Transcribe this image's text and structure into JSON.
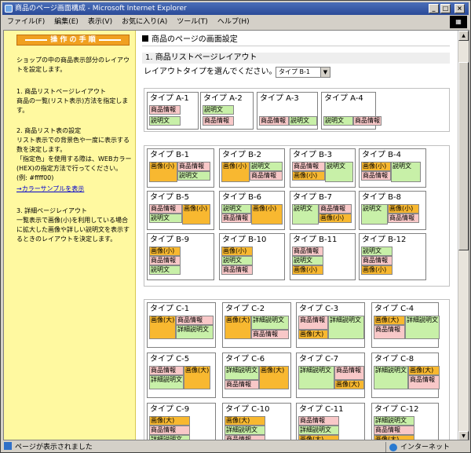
{
  "window": {
    "title": "商品のページ画面構成 - Microsoft Internet Explorer"
  },
  "menu": [
    "ファイル(F)",
    "編集(E)",
    "表示(V)",
    "お気に入り(A)",
    "ツール(T)",
    "ヘルプ(H)"
  ],
  "sidebar": {
    "heading": "操 作 の 手 順",
    "intro": "ショップの中の商品表示部分のレイアウトを設定します。",
    "step1_title": "1. 商品リストページレイアウト",
    "step1_body": "商品の一覧(リスト表示)方法を指定します。",
    "step2_title": "2. 商品リスト表の設定",
    "step2_body": "リスト表示での背景色や一度に表示する数を決定します。",
    "step2_note": "「指定色」を使用する際は、WEBカラー(HEX)の指定方法で行ってください。",
    "step2_example": "(例: #ffff00)",
    "color_link": "→カラーサンプルを表示",
    "step3_title": "3. 詳細ページレイアウト",
    "step3_body": "一覧表示で画像(小)を利用している場合に拡大した画像や詳しい説明文を表示するときのレイアウトを決定します。"
  },
  "main": {
    "title": "商品のページの画面設定",
    "section1": "1. 商品リストページレイアウト",
    "layout_prompt": "レイアウトタイプを選んでください。",
    "layout_selected": "タイプ B-1"
  },
  "groupA": [
    {
      "t": "タイプ A-1",
      "b": [
        "商品情報",
        "説明文"
      ]
    },
    {
      "t": "タイプ A-2",
      "b": [
        "説明文",
        "商品情報"
      ]
    },
    {
      "t": "タイプ A-3",
      "b": [
        "商品情報",
        "説明文"
      ]
    },
    {
      "t": "タイプ A-4",
      "b": [
        "説明文",
        "商品情報"
      ]
    }
  ],
  "groupB": [
    {
      "t": "タイプ B-1"
    },
    {
      "t": "タイプ B-2"
    },
    {
      "t": "タイプ B-3"
    },
    {
      "t": "タイプ B-4"
    },
    {
      "t": "タイプ B-5"
    },
    {
      "t": "タイプ B-6"
    },
    {
      "t": "タイプ B-7"
    },
    {
      "t": "タイプ B-8"
    },
    {
      "t": "タイプ B-9"
    },
    {
      "t": "タイプ B-10"
    },
    {
      "t": "タイプ B-11"
    },
    {
      "t": "タイプ B-12"
    }
  ],
  "groupC": [
    {
      "t": "タイプ C-1"
    },
    {
      "t": "タイプ C-2"
    },
    {
      "t": "タイプ C-3"
    },
    {
      "t": "タイプ C-4"
    },
    {
      "t": "タイプ C-5"
    },
    {
      "t": "タイプ C-6"
    },
    {
      "t": "タイプ C-7"
    },
    {
      "t": "タイプ C-8"
    },
    {
      "t": "タイプ C-9"
    },
    {
      "t": "タイプ C-10"
    },
    {
      "t": "タイプ C-11"
    },
    {
      "t": "タイプ C-12"
    }
  ],
  "labels": {
    "info": "商品情報",
    "desc": "説明文",
    "imgS": "画像(小)",
    "imgL": "画像(大)",
    "detail": "詳細説明文"
  },
  "status": {
    "text": "ページが表示されました",
    "zone": "インターネット"
  }
}
